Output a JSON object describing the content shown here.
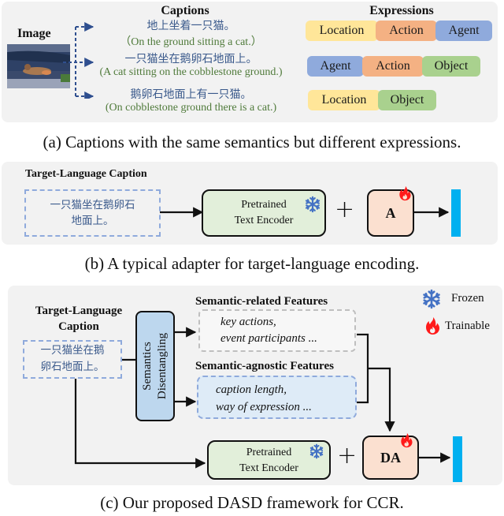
{
  "panel_a": {
    "image_label": "Image",
    "captions_header": "Captions",
    "expressions_header": "Expressions",
    "captions": [
      {
        "cn": "地上坐着一只猫。",
        "en": "（On the ground sitting a cat.）"
      },
      {
        "cn": "一只猫坐在鹅卵石地面上。",
        "en": "(A cat sitting on the cobblestone ground.)"
      },
      {
        "cn": "鹅卵石地面上有一只猫。",
        "en": "(On cobblestone ground there is a cat.)"
      }
    ],
    "expressions": [
      [
        "Location",
        "Action",
        "Agent"
      ],
      [
        "Agent",
        "Action",
        "Object"
      ],
      [
        "Location",
        "Object"
      ]
    ],
    "colors": {
      "Location": "#ffe699",
      "Action": "#f4b183",
      "Agent": "#8faadc",
      "Object": "#a9d18e"
    },
    "figure_caption": "(a) Captions with the same semantics but different expressions."
  },
  "panel_b": {
    "input_title": "Target-Language Caption",
    "input_text_line1": "一只猫坐在鹅卵石",
    "input_text_line2": "地面上。",
    "encoder_line1": "Pretrained",
    "encoder_line2": "Text Encoder",
    "plus": "+",
    "adapter_label": "A",
    "figure_caption": "(b) A typical adapter for target-language encoding."
  },
  "panel_c": {
    "input_title_line1": "Target-Language",
    "input_title_line2": "Caption",
    "input_text_line1": "一只猫坐在鹅",
    "input_text_line2": "卵石地面上。",
    "disentangle_line1": "Semantics",
    "disentangle_line2": "Disentangling",
    "related_title": "Semantic-related Features",
    "related_line1": "key actions,",
    "related_line2": "event participants  ...",
    "agnostic_title": "Semantic-agnostic Features",
    "agnostic_line1": "caption length,",
    "agnostic_line2": "way of expression ...",
    "encoder_line1": "Pretrained",
    "encoder_line2": "Text Encoder",
    "plus": "+",
    "adapter_label": "DA",
    "legend_frozen": "Frozen",
    "legend_trainable": "Trainable",
    "figure_caption": "(c) Our proposed DASD framework for CCR."
  },
  "colors": {
    "panel_bg": "#f2f2f2",
    "encoder_fill": "#e2efda",
    "adapter_fill": "#fbe0d0",
    "output_bar": "#00b0f0",
    "snowflake": "#4472c4",
    "flame": "#ff1a1a",
    "dashed_blue": "#8faadc"
  }
}
